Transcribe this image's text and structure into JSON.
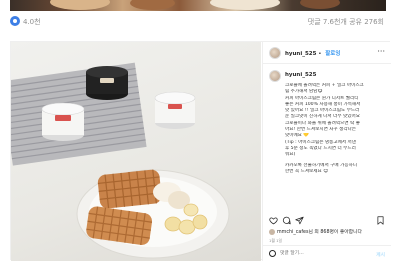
{
  "prev_post": {
    "views": "4.0천",
    "stats": "댓글 7.6천개  공유 276회"
  },
  "post": {
    "username": "hyuni_525",
    "separator": " • ",
    "follow_label": "팔로잉",
    "caption_username": "hyuni_525",
    "caption_lines": [
      "크로플에 올려먹는 커피 + 밀크 아이스크",
      "림 추가해서 냠냠😋",
      "커피 아이스크림은 뭔가 디저트 퀄리티",
      "좋은 커피 100% 사용해 풍미 가득해서",
      "맛 있어요 !! 밀크 아이스크림도 부드러",
      "운 밀크맛이 진하게 나서 너무 맛있어요",
      "크로플이나 와플 위에 올려먹으면 딱 좋",
      "아요! 한번 드셔보시면 자꾸 생각나는",
      "맛이에요 💛",
      "(Tip : 아이스크림은 냉동고에서 꺼낸",
      "후 5분 정도 녹였다 드시면 더 부드러",
      "워요)",
      "",
      "카카오톡 선물하기에서 구매 가능하니",
      "한번 꼭 드셔보세요 😊"
    ],
    "likes_text": "mmchi_cafes님 외 868명이 좋아합니다",
    "date": "1월 1일",
    "comment_placeholder": "댓글 달기...",
    "post_label": "게시"
  },
  "colors": {
    "accent": "#3897f0",
    "views_icon": "#3d7fe6"
  },
  "icons": {
    "like": "heart-icon",
    "comment": "comment-icon",
    "share": "send-icon",
    "save": "bookmark-icon",
    "more": "more-horizontal-icon",
    "emoji": "emoji-icon",
    "views": "views-icon"
  }
}
